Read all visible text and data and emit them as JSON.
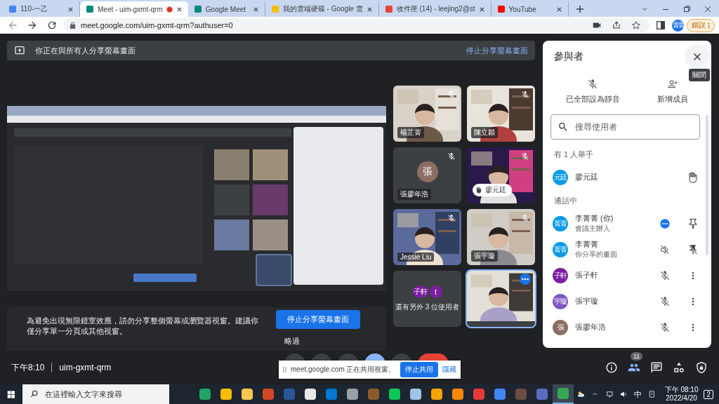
{
  "browser": {
    "tabs": [
      {
        "title": "110-一乙",
        "selected": false,
        "recording": false
      },
      {
        "title": "Meet - uim-gxmt-qrm",
        "selected": true,
        "recording": true
      },
      {
        "title": "Google Meet",
        "selected": false,
        "recording": false
      },
      {
        "title": "我的雲端硬碟 - Google 雲",
        "selected": false,
        "recording": false
      },
      {
        "title": "收件匣 (14) - leejing2@st",
        "selected": false,
        "recording": false
      },
      {
        "title": "YouTube",
        "selected": false,
        "recording": false
      }
    ],
    "url": "meet.google.com/uim-gxmt-qrm?authuser=0",
    "profile": "菁菁",
    "error_button": "錯誤"
  },
  "share_banner": {
    "text": "你正在與所有人分享螢幕畫面",
    "action": "停止分享螢幕畫面"
  },
  "warning": {
    "text": "為避免出現無限鏡室效應，請勿分享整個螢幕或瀏覽器視窗。建議你僅分享單一分頁或其他視窗。",
    "button": "停止分享螢幕畫面",
    "skip": "略過"
  },
  "tiles": [
    {
      "kind": "video",
      "name": "楊芷菁",
      "muted": true,
      "hand_raised": false
    },
    {
      "kind": "video",
      "name": "陳立穎",
      "muted": true,
      "hand_raised": false
    },
    {
      "kind": "avatar",
      "avatar": "張",
      "color": "#8d6e63",
      "name": "張廖年浩",
      "muted": true,
      "hand_raised": false
    },
    {
      "kind": "video",
      "name": "廖元廷",
      "muted": true,
      "hand_raised": true
    },
    {
      "kind": "video",
      "name": "Jessie Liu",
      "muted": true,
      "hand_raised": false
    },
    {
      "kind": "video",
      "name": "張宇璇",
      "muted": true,
      "hand_raised": false
    },
    {
      "kind": "more",
      "avatars": [
        {
          "text": "子軒",
          "color": "#7b1fa2"
        },
        {
          "text": "t",
          "color": "#7b1fa2"
        }
      ],
      "label": "還有另外 3 位使用者"
    },
    {
      "kind": "self",
      "highlighted": true
    }
  ],
  "panel": {
    "title": "參與者",
    "tooltip": "關閉",
    "actions": [
      {
        "kind": "mute",
        "label": "已全部設為靜音"
      },
      {
        "kind": "add",
        "label": "新增成員"
      }
    ],
    "search": {
      "placeholder": "搜尋使用者"
    },
    "sections": [
      {
        "title": "有 1 人舉手",
        "people": [
          {
            "avatar": "元廷",
            "color": "#039be5",
            "name": "廖元廷",
            "actions": [
              {
                "kind": "hand"
              }
            ]
          }
        ]
      },
      {
        "title": "通話中",
        "people": [
          {
            "avatar": "菁菁",
            "color": "#039be5",
            "name": "李菁菁 (你)",
            "sub": "會議主辦人",
            "actions": [
              {
                "kind": "more"
              },
              {
                "kind": "pin"
              }
            ]
          },
          {
            "avatar": "菁菁",
            "color": "#039be5",
            "name": "李菁菁",
            "sub": "你分享的畫面",
            "actions": [
              {
                "kind": "audio-off"
              },
              {
                "kind": "unpin"
              }
            ]
          },
          {
            "avatar": "子軒",
            "color": "#7b1fa2",
            "name": "張子軒",
            "actions": [
              {
                "kind": "mute"
              },
              {
                "kind": "menu"
              }
            ]
          },
          {
            "avatar": "宇璇",
            "color": "#7e57c2",
            "name": "張宇璇",
            "actions": [
              {
                "kind": "mute"
              },
              {
                "kind": "menu"
              }
            ]
          },
          {
            "avatar": "張",
            "color": "#8d6e63",
            "name": "張廖年浩",
            "actions": [
              {
                "kind": "mute"
              },
              {
                "kind": "menu"
              }
            ]
          }
        ]
      }
    ]
  },
  "bottom": {
    "time": "下午8:10",
    "code": "uim-gxmt-qrm",
    "controls": [
      {
        "color": "#3c4043"
      },
      {
        "color": "#3c4043"
      },
      {
        "color": "#3c4043"
      },
      {
        "color": "#8ab4f8"
      },
      {
        "color": "#3c4043"
      },
      {
        "color": "#ea4335"
      }
    ],
    "tools": [
      {
        "kind": "info",
        "selected": false
      },
      {
        "kind": "people",
        "selected": true,
        "badge": "11"
      },
      {
        "kind": "chat",
        "selected": false
      },
      {
        "kind": "activities",
        "selected": false
      },
      {
        "kind": "safety",
        "selected": false
      }
    ]
  },
  "infobar": {
    "text": "meet.google.com 正在共用視窗。",
    "button": "停止共用",
    "link": "隱藏"
  },
  "taskbar": {
    "search": {
      "placeholder": "在這裡輸入文字來搜尋"
    },
    "apps": [
      {
        "color": "#21a366",
        "selected": false
      },
      {
        "color": "#fbbc04",
        "selected": false
      },
      {
        "color": "#f9c74f",
        "selected": false
      },
      {
        "color": "#d24726",
        "selected": false
      },
      {
        "color": "#2b579a",
        "selected": false
      },
      {
        "color": "#e8e8e8",
        "selected": false
      },
      {
        "color": "#0078d4",
        "selected": false
      },
      {
        "color": "#9aa0a6",
        "selected": false
      },
      {
        "color": "#8b5a2b",
        "selected": false
      },
      {
        "color": "#06c755",
        "selected": false
      },
      {
        "color": "#a0c4e8",
        "selected": false
      },
      {
        "color": "#f4a300",
        "selected": false
      },
      {
        "color": "#ff8800",
        "selected": false
      },
      {
        "color": "#e53935",
        "selected": false
      },
      {
        "color": "#4285f4",
        "selected": false
      },
      {
        "color": "#6d4c41",
        "selected": false
      },
      {
        "color": "#5c6bc0",
        "selected": false
      },
      {
        "color": "#34a853",
        "selected": true
      }
    ],
    "ime": "中",
    "time": "下午 08:10",
    "date": "2022/4/20",
    "notifications": "2"
  }
}
